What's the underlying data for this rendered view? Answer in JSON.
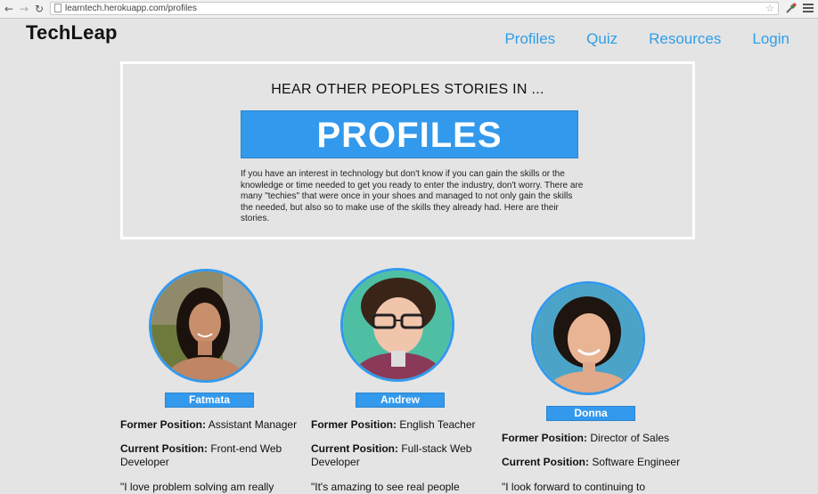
{
  "browser": {
    "url": "learntech.herokuapp.com/profiles",
    "back_icon": "←",
    "forward_icon": "→",
    "reload_icon": "↻",
    "star_icon": "☆"
  },
  "header": {
    "brand": "TechLeap",
    "nav": [
      "Profiles",
      "Quiz",
      "Resources",
      "Login"
    ]
  },
  "hero": {
    "kicker": "HEAR OTHER PEOPLES STORIES IN ...",
    "banner": "PROFILES",
    "description": "If you have an interest in technology but don't know if you can gain the skills or the knowledge or time needed to get you ready to enter the industry, don't worry. There are many \"techies\" that were once in your shoes and managed to not only gain the skills the needed, but also so to make use of the skills they already had. Here are their stories."
  },
  "labels": {
    "former": "Former Position:",
    "current": "Current Position:"
  },
  "profiles": [
    {
      "name": "Fatmata",
      "former": "Assistant Manager",
      "current": "Front-end Web Developer",
      "quote": "\"I love problem solving am really"
    },
    {
      "name": "Andrew",
      "former": "English Teacher",
      "current": "Full-stack Web Developer",
      "quote": "\"It's amazing to see real people"
    },
    {
      "name": "Donna",
      "former": "Director of Sales",
      "current": "Software Engineer",
      "quote": "\"I look forward to continuing to"
    }
  ],
  "colors": {
    "accent": "#3399ec",
    "background": "#e4e4e4"
  }
}
